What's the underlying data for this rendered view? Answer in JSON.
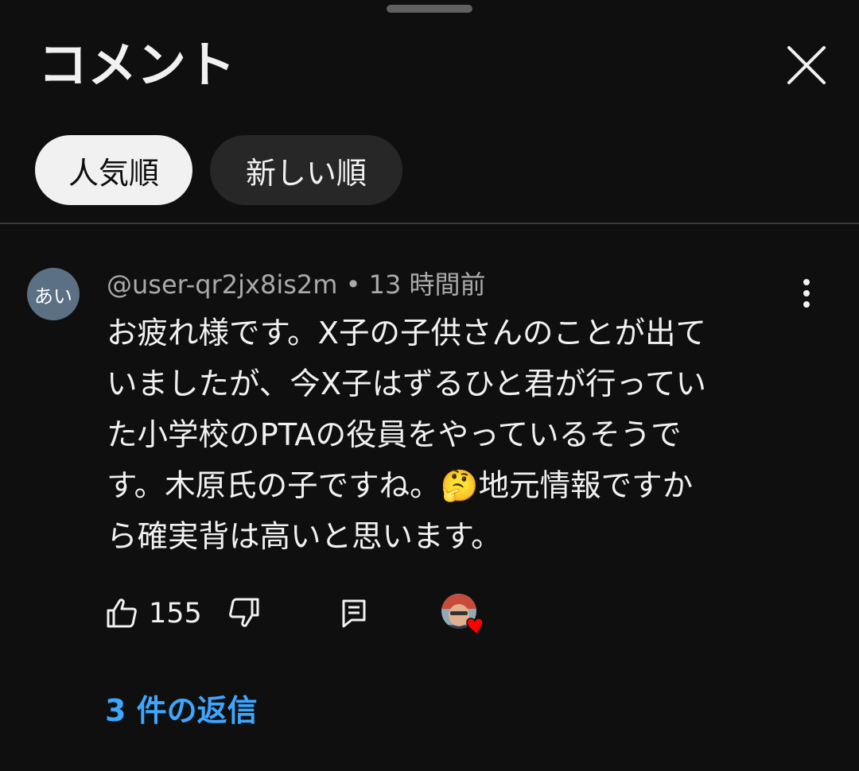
{
  "header": {
    "title": "コメント",
    "close_icon": "close-icon"
  },
  "sort_chips": {
    "popular": "人気順",
    "newest": "新しい順",
    "selected": "人気順"
  },
  "comment": {
    "avatar_text": "あい",
    "username": "@user-qr2jx8is2m",
    "separator": "•",
    "time": "13 時間前",
    "body_lines": [
      "お疲れ様です。X子の子供さんのことが出て",
      "いましたが、今X子はずるひと君が行ってい",
      "た小学校のPTAの役員をやっているそうで",
      "す。木原氏の子ですね。🤔地元情報ですか",
      "ら確実背は高いと思います。"
    ],
    "like_count": "155",
    "creator_heart": true
  },
  "replies": {
    "label": "3 件の返信"
  },
  "colors": {
    "background": "#0f0f0f",
    "accent_link": "#3ea6ff",
    "chip_selected_bg": "#f1f1f1",
    "chip_bg": "#272727",
    "avatar_bg": "#5b7083",
    "heart": "#ff0000"
  }
}
